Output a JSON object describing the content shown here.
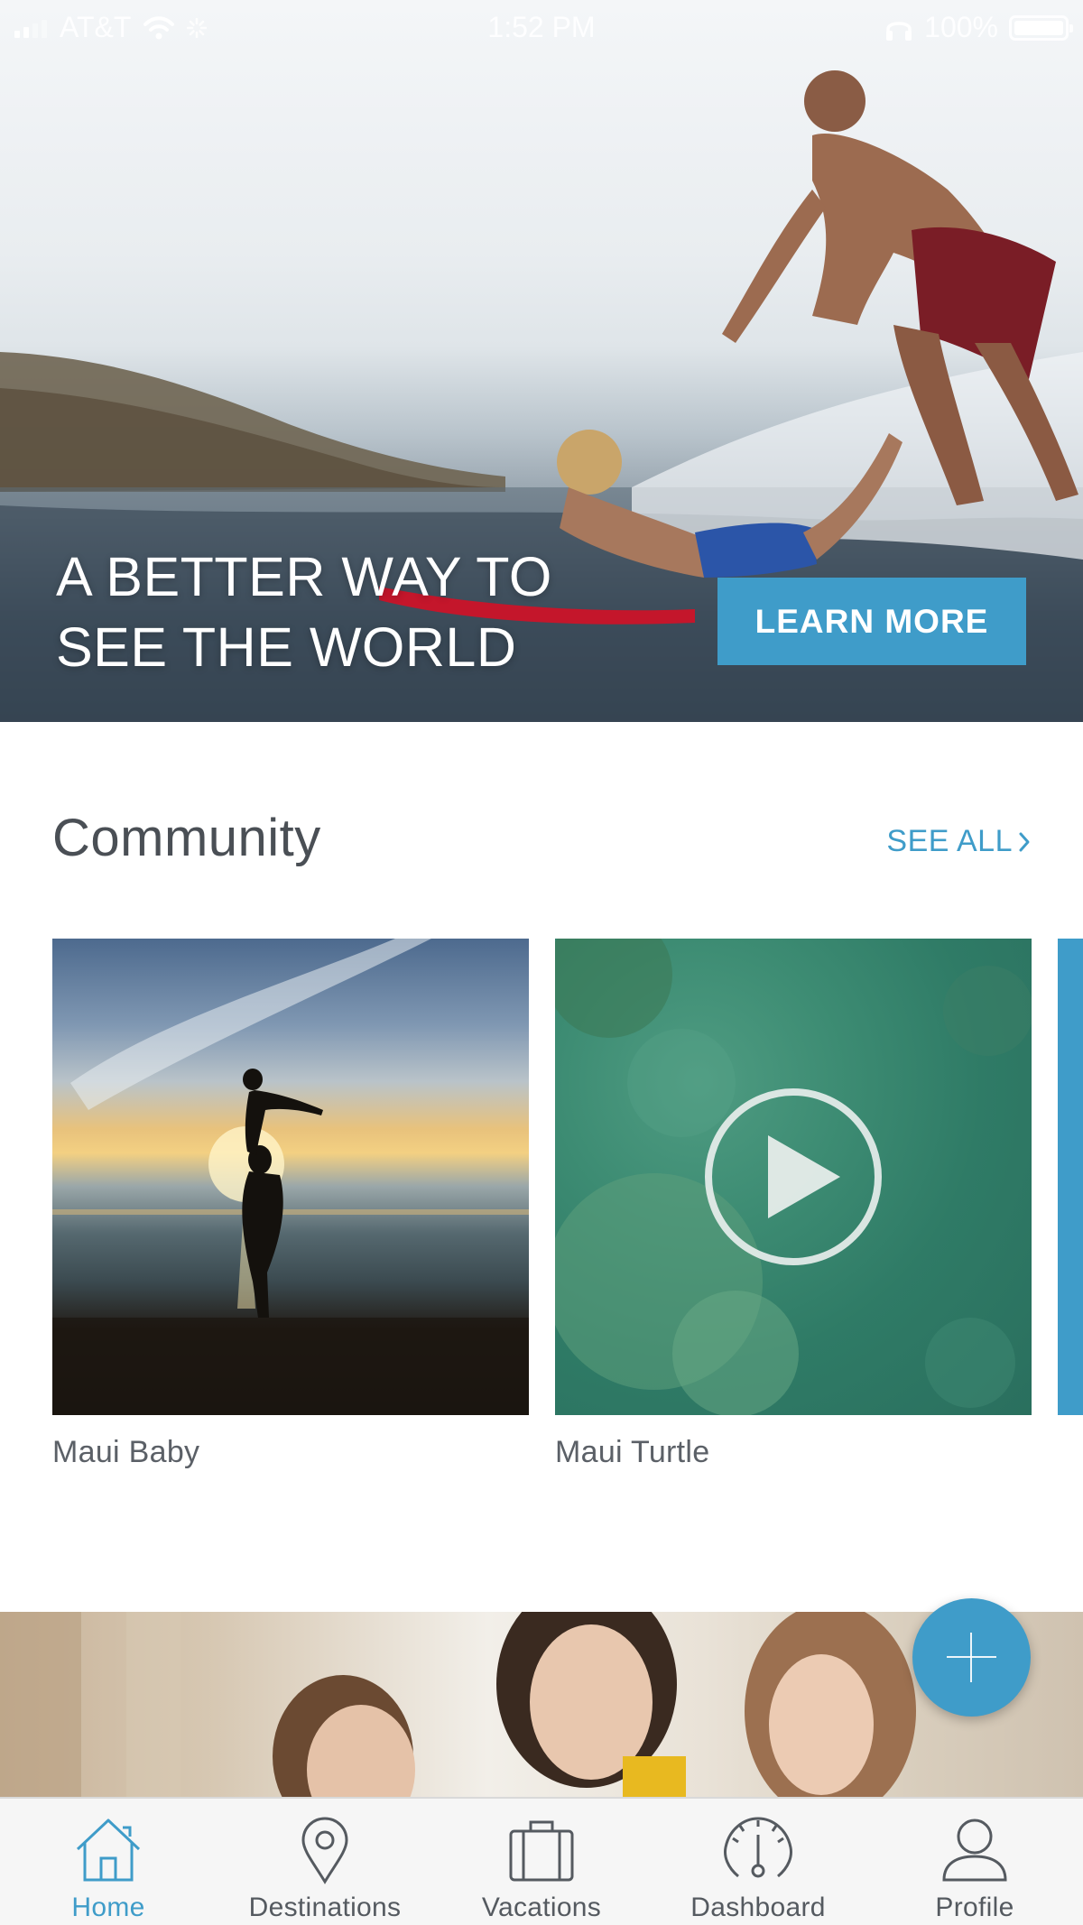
{
  "status_bar": {
    "carrier": "AT&T",
    "time": "1:52 PM",
    "battery": "100%"
  },
  "hero": {
    "headline_line1": "A BETTER WAY TO",
    "headline_line2": "SEE THE WORLD",
    "cta_label": "LEARN MORE"
  },
  "community": {
    "title": "Community",
    "see_all_label": "SEE ALL",
    "cards": [
      {
        "caption": "Maui Baby",
        "media": "photo"
      },
      {
        "caption": "Maui Turtle",
        "media": "video"
      }
    ]
  },
  "tab_bar": {
    "active": "Home",
    "tabs": [
      {
        "label": "Home",
        "icon": "home-icon"
      },
      {
        "label": "Destinations",
        "icon": "map-pin-icon"
      },
      {
        "label": "Vacations",
        "icon": "suitcase-icon"
      },
      {
        "label": "Dashboard",
        "icon": "gauge-icon"
      },
      {
        "label": "Profile",
        "icon": "user-icon"
      }
    ]
  },
  "colors": {
    "accent": "#3f9cc9",
    "text": "#4a4f55",
    "tab_inactive": "#555a60"
  }
}
